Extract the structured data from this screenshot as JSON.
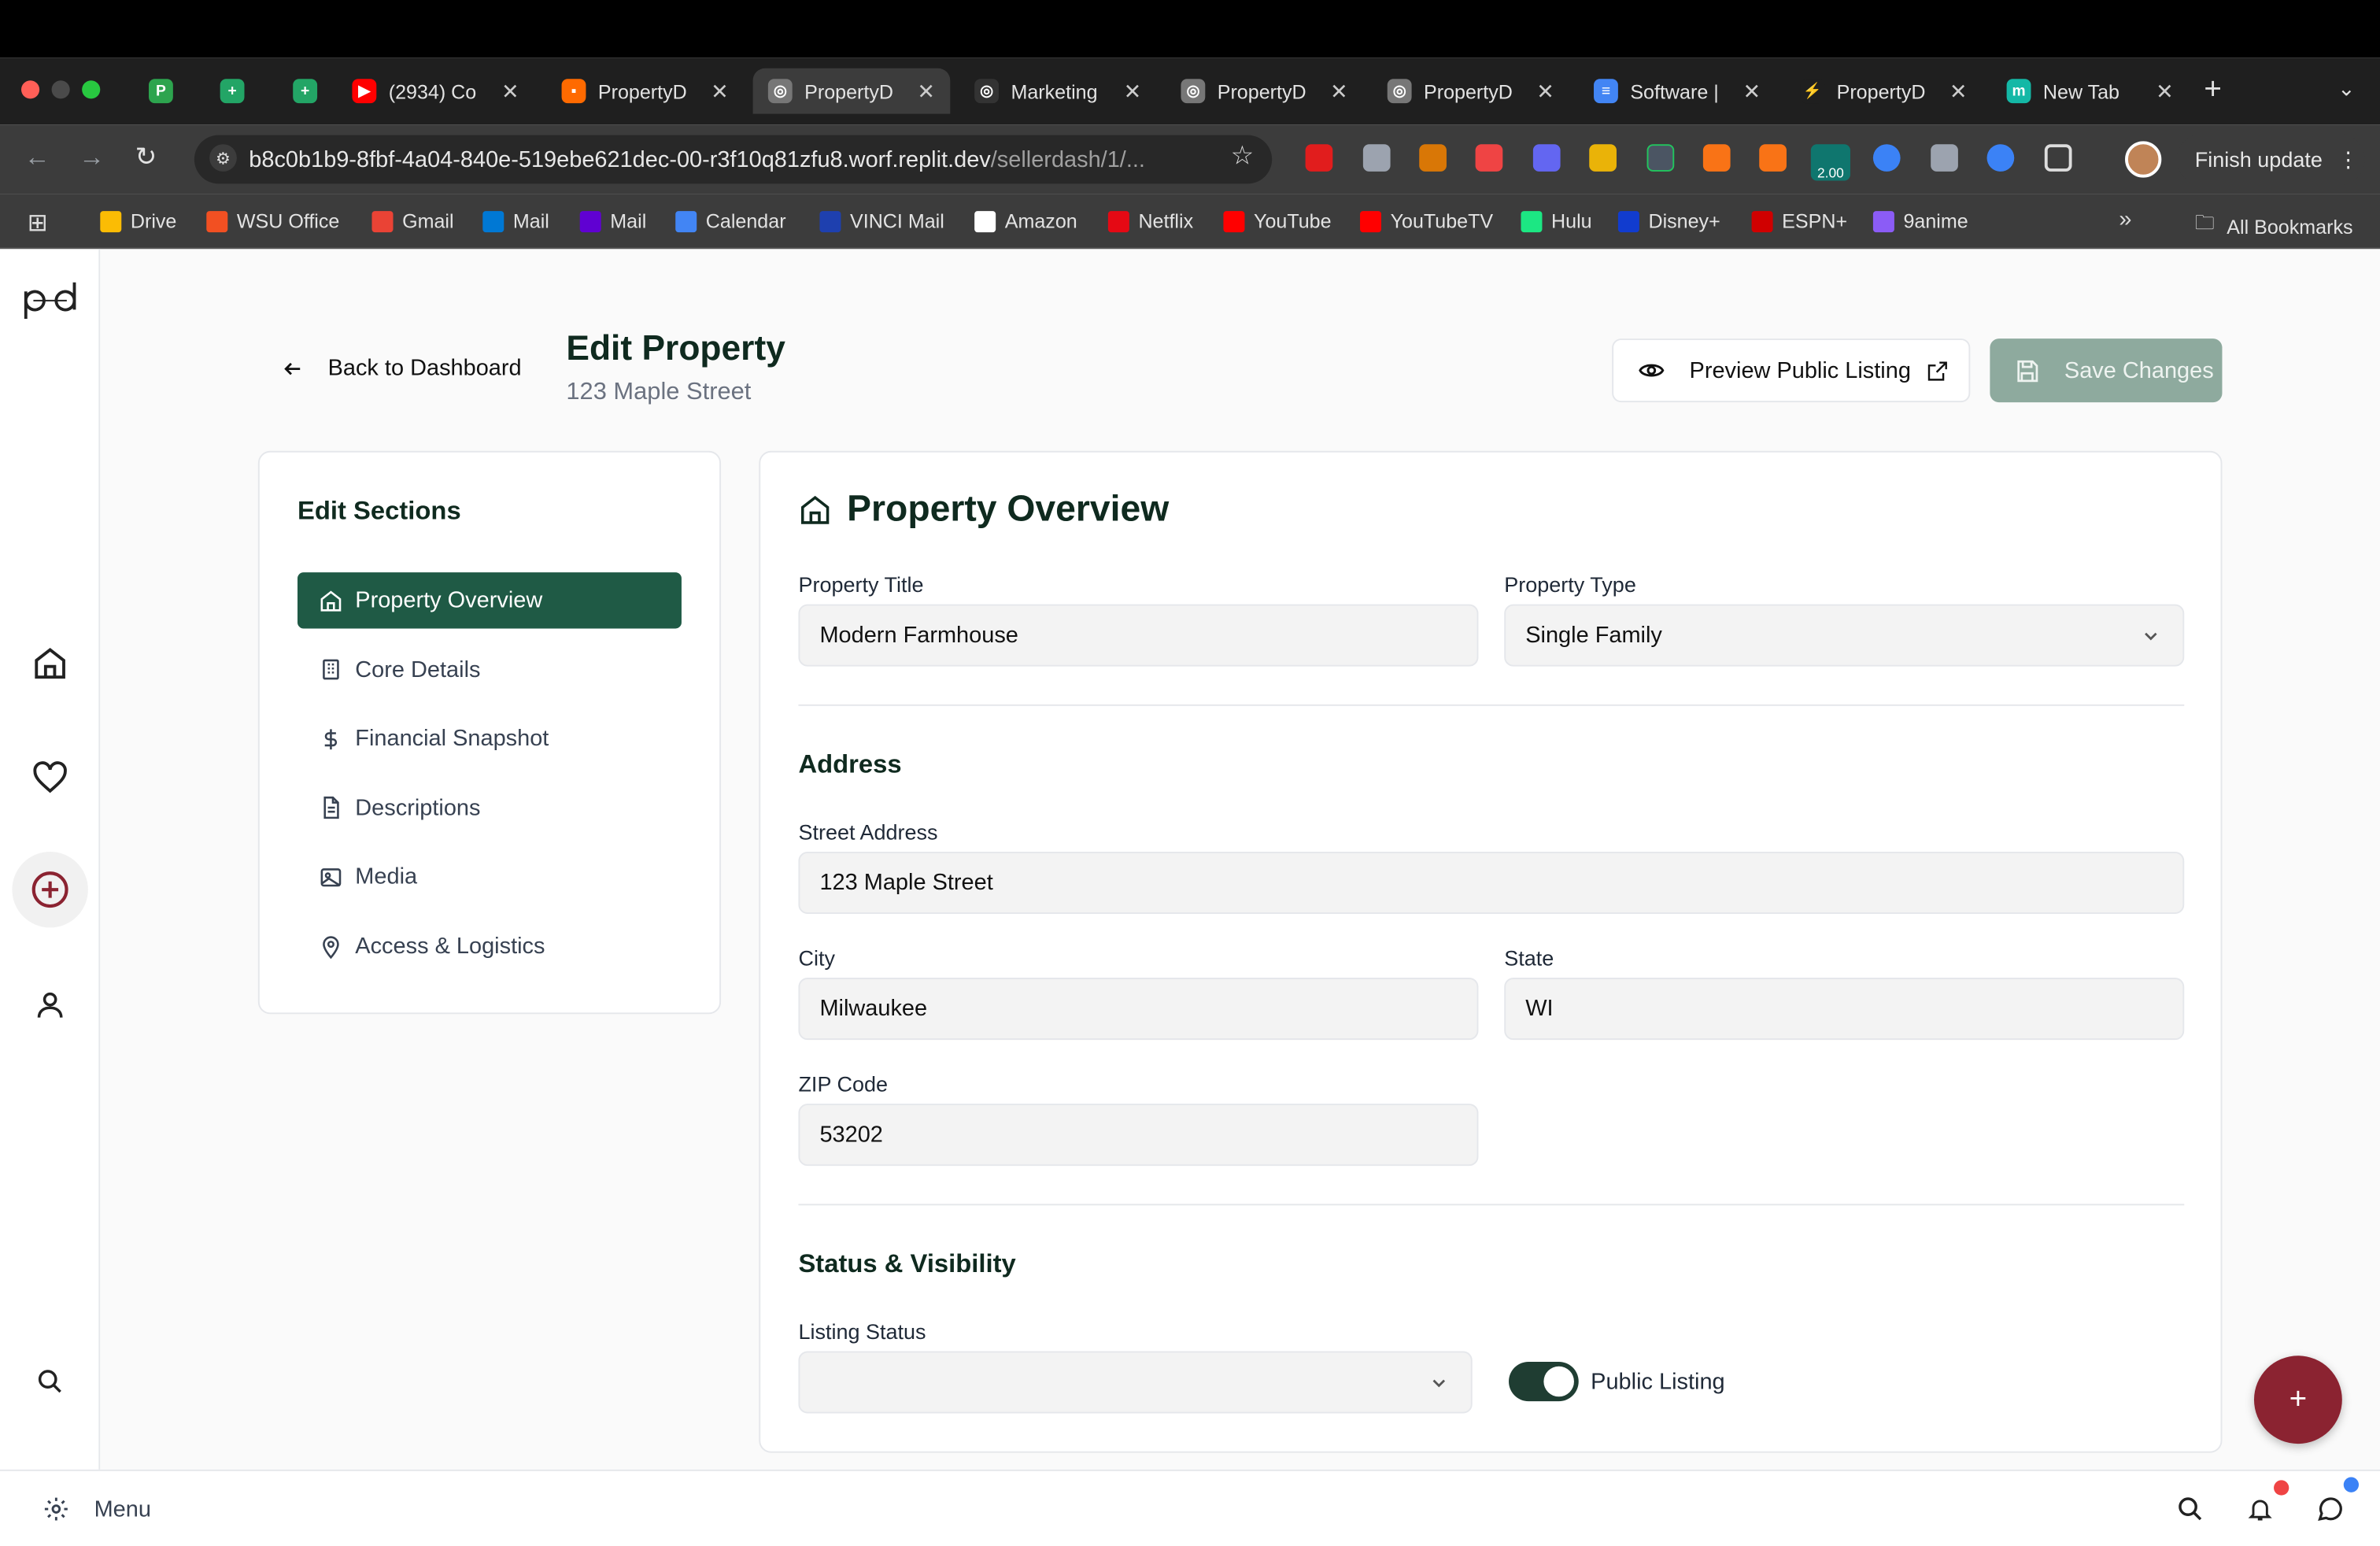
{
  "browser": {
    "tabs": [
      {
        "title": "",
        "favicon": "P",
        "color": "#2da44e"
      },
      {
        "title": "",
        "favicon": "+",
        "color": "#23a566"
      },
      {
        "title": "",
        "favicon": "+",
        "color": "#23a566"
      },
      {
        "title": "(2934) Co",
        "favicon": "▶",
        "color": "#ff0000"
      },
      {
        "title": "PropertyD",
        "favicon": "▪",
        "color": "#ff6a00"
      },
      {
        "title": "PropertyD",
        "favicon": "◎",
        "color": "#777777"
      },
      {
        "title": "Marketing",
        "favicon": "◎",
        "color": "#333333"
      },
      {
        "title": "PropertyD",
        "favicon": "◎",
        "color": "#777777"
      },
      {
        "title": "PropertyD",
        "favicon": "◎",
        "color": "#777777"
      },
      {
        "title": "Software |",
        "favicon": "≡",
        "color": "#4285f4"
      },
      {
        "title": "PropertyD",
        "favicon": "⚡",
        "color": "#1f1f1f"
      },
      {
        "title": "New Tab",
        "favicon": "m",
        "color": "#14b8a6"
      }
    ],
    "url_main": "b8c0b1b9-8fbf-4a04-840e-519ebe621dec-00-r3f10q81zfu8.worf.replit.dev",
    "url_path": "/sellerdash/1/...",
    "finish_update": "Finish update",
    "ext_badge": "2.00",
    "bookmarks": [
      {
        "label": "Drive",
        "color": "#fbbc04"
      },
      {
        "label": "WSU Office",
        "color": "#f25022"
      },
      {
        "label": "Gmail",
        "color": "#ea4335"
      },
      {
        "label": "Mail",
        "color": "#0078d4"
      },
      {
        "label": "Mail",
        "color": "#6001d2"
      },
      {
        "label": "Calendar",
        "color": "#4285f4"
      },
      {
        "label": "VINCI Mail",
        "color": "#1e40af"
      },
      {
        "label": "Amazon",
        "color": "#ffffff"
      },
      {
        "label": "Netflix",
        "color": "#e50914"
      },
      {
        "label": "YouTube",
        "color": "#ff0000"
      },
      {
        "label": "YouTubeTV",
        "color": "#ff0000"
      },
      {
        "label": "Hulu",
        "color": "#1ce783"
      },
      {
        "label": "Disney+",
        "color": "#113ccf"
      },
      {
        "label": "ESPN+",
        "color": "#d00000"
      },
      {
        "label": "9anime",
        "color": "#8b5cf6"
      }
    ],
    "all_bookmarks": "All Bookmarks"
  },
  "header": {
    "back_label": "Back to Dashboard",
    "title": "Edit Property",
    "subtitle": "123 Maple Street",
    "preview_label": "Preview Public Listing",
    "save_label": "Save Changes"
  },
  "sections": {
    "heading": "Edit Sections",
    "items": [
      {
        "label": "Property Overview",
        "icon": "home-icon"
      },
      {
        "label": "Core Details",
        "icon": "building-icon"
      },
      {
        "label": "Financial Snapshot",
        "icon": "dollar-icon"
      },
      {
        "label": "Descriptions",
        "icon": "document-icon"
      },
      {
        "label": "Media",
        "icon": "image-icon"
      },
      {
        "label": "Access & Logistics",
        "icon": "map-pin-icon"
      }
    ]
  },
  "overview": {
    "title": "Property Overview",
    "property_title_label": "Property Title",
    "property_title_value": "Modern Farmhouse",
    "property_type_label": "Property Type",
    "property_type_value": "Single Family",
    "address_heading": "Address",
    "street_label": "Street Address",
    "street_value": "123 Maple Street",
    "city_label": "City",
    "city_value": "Milwaukee",
    "state_label": "State",
    "state_value": "WI",
    "zip_label": "ZIP Code",
    "zip_value": "53202",
    "status_heading": "Status & Visibility",
    "listing_status_label": "Listing Status",
    "listing_status_value": "",
    "public_listing_label": "Public Listing",
    "public_listing_on": true
  },
  "footer": {
    "menu_label": "Menu"
  },
  "colors": {
    "brand_green": "#1f5a45",
    "save_disabled": "#8eaa9e",
    "fab": "#8b2331"
  }
}
